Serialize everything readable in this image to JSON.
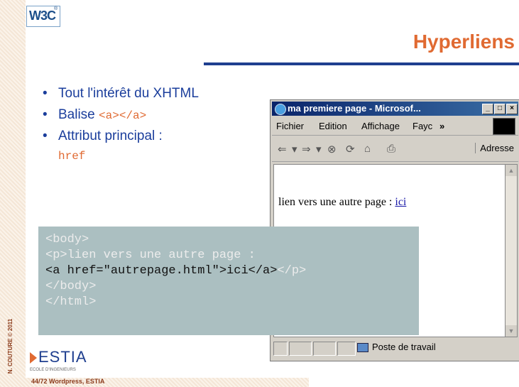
{
  "slide": {
    "title": "Hyperliens",
    "bullets": [
      {
        "text": "Tout l'intérêt du XHTML"
      },
      {
        "text": "Balise ",
        "code": "<a></a>"
      },
      {
        "text": "Attribut principal :",
        "cont": "href"
      }
    ],
    "code_lines": [
      "<body>",
      "<p>lien vers une autre page :",
      "<a href=\"autrepage.html\">ici</a>",
      "</p>",
      "</body>",
      "</html>"
    ],
    "footer": "44/72  Wordpress, ESTIA",
    "credit": "N. COUTURE  © 2011",
    "logo_text": "ESTIA",
    "logo_sub": "ECOLE D'INGENIEURS",
    "w3c_logo": "W3C"
  },
  "browser": {
    "title": "ma premiere page - Microsof...",
    "menu": [
      "Fichier",
      "Edition",
      "Affichage",
      "Fayc"
    ],
    "menu_more": "»",
    "address_label": "Adresse",
    "content_text": "lien vers une autre page : ",
    "link_text": "ici",
    "status_text": "Poste de travail"
  },
  "colors": {
    "accent": "#e06a32",
    "blue": "#1b3e9c",
    "codebox": "#abbfc1",
    "rule": "#1f3f8f"
  }
}
